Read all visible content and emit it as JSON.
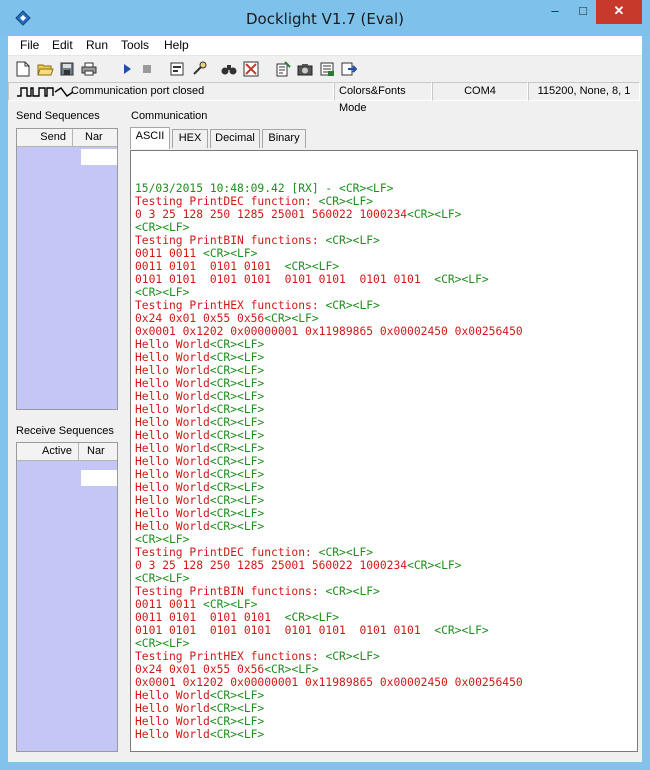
{
  "window": {
    "title": "Docklight V1.7 (Eval)",
    "min_glyph": "–",
    "max_glyph": "□",
    "close_glyph": "✕"
  },
  "menu": [
    "File",
    "Edit",
    "Run",
    "Tools",
    "Help"
  ],
  "toolbar_icons": [
    "new-file-icon",
    "open-folder-icon",
    "save-icon",
    "print-icon",
    "play-icon",
    "stop-icon",
    "properties-icon",
    "keyboard-icon",
    "binoculars-icon",
    "clear-icon",
    "edit-notes-icon",
    "snapshot-icon",
    "logging-icon",
    "export-icon"
  ],
  "status": {
    "port_text": "Communication port closed",
    "mode": "Colors&Fonts Mode",
    "com_port": "COM4",
    "settings": "115200, None, 8, 1"
  },
  "send_panel": {
    "title": "Send Sequences",
    "col_send": "Send",
    "col_name": "Nar"
  },
  "receive_panel": {
    "title": "Receive Sequences",
    "col_active": "Active",
    "col_name": "Nar"
  },
  "communication": {
    "title": "Communication",
    "tabs": [
      "ASCII",
      "HEX",
      "Decimal",
      "Binary"
    ],
    "active_tab": "ASCII"
  },
  "colors": {
    "rx_header": "#1e8c1e",
    "data_text": "#d01818",
    "control_chars": "#1e8c1e",
    "sequence_bg": "#c4c7f6",
    "titlebar": "#7ec2ec"
  },
  "terminal_lines": [
    [
      {
        "t": "",
        "c": "green"
      }
    ],
    [
      {
        "t": "15/03/2015 10:48:09.42 [RX] - <CR><LF>",
        "c": "green"
      }
    ],
    [
      {
        "t": "Testing PrintDEC function: ",
        "c": "red"
      },
      {
        "t": "<CR><LF>",
        "c": "green"
      }
    ],
    [
      {
        "t": "0 3 25 128 250 1285 25001 560022 1000234",
        "c": "red"
      },
      {
        "t": "<CR><LF>",
        "c": "green"
      }
    ],
    [
      {
        "t": "<CR><LF>",
        "c": "green"
      }
    ],
    [
      {
        "t": "Testing PrintBIN functions: ",
        "c": "red"
      },
      {
        "t": "<CR><LF>",
        "c": "green"
      }
    ],
    [
      {
        "t": "0011 0011 ",
        "c": "red"
      },
      {
        "t": "<CR><LF>",
        "c": "green"
      }
    ],
    [
      {
        "t": "0011 0101  0101 0101  ",
        "c": "red"
      },
      {
        "t": "<CR><LF>",
        "c": "green"
      }
    ],
    [
      {
        "t": "0101 0101  0101 0101  0101 0101  0101 0101  ",
        "c": "red"
      },
      {
        "t": "<CR><LF>",
        "c": "green"
      }
    ],
    [
      {
        "t": "<CR><LF>",
        "c": "green"
      }
    ],
    [
      {
        "t": "Testing PrintHEX functions: ",
        "c": "red"
      },
      {
        "t": "<CR><LF>",
        "c": "green"
      }
    ],
    [
      {
        "t": "0x24 0x01 0x55 0x56",
        "c": "red"
      },
      {
        "t": "<CR><LF>",
        "c": "green"
      }
    ],
    [
      {
        "t": "0x0001 0x1202 0x00000001 0x11989865 0x00002450 0x00256450",
        "c": "red"
      }
    ],
    [
      {
        "t": "Hello World",
        "c": "red"
      },
      {
        "t": "<CR><LF>",
        "c": "green"
      }
    ],
    [
      {
        "t": "Hello World",
        "c": "red"
      },
      {
        "t": "<CR><LF>",
        "c": "green"
      }
    ],
    [
      {
        "t": "Hello World",
        "c": "red"
      },
      {
        "t": "<CR><LF>",
        "c": "green"
      }
    ],
    [
      {
        "t": "Hello World",
        "c": "red"
      },
      {
        "t": "<CR><LF>",
        "c": "green"
      }
    ],
    [
      {
        "t": "Hello World",
        "c": "red"
      },
      {
        "t": "<CR><LF>",
        "c": "green"
      }
    ],
    [
      {
        "t": "Hello World",
        "c": "red"
      },
      {
        "t": "<CR><LF>",
        "c": "green"
      }
    ],
    [
      {
        "t": "Hello World",
        "c": "red"
      },
      {
        "t": "<CR><LF>",
        "c": "green"
      }
    ],
    [
      {
        "t": "Hello World",
        "c": "red"
      },
      {
        "t": "<CR><LF>",
        "c": "green"
      }
    ],
    [
      {
        "t": "Hello World",
        "c": "red"
      },
      {
        "t": "<CR><LF>",
        "c": "green"
      }
    ],
    [
      {
        "t": "Hello World",
        "c": "red"
      },
      {
        "t": "<CR><LF>",
        "c": "green"
      }
    ],
    [
      {
        "t": "Hello World",
        "c": "red"
      },
      {
        "t": "<CR><LF>",
        "c": "green"
      }
    ],
    [
      {
        "t": "Hello World",
        "c": "red"
      },
      {
        "t": "<CR><LF>",
        "c": "green"
      }
    ],
    [
      {
        "t": "Hello World",
        "c": "red"
      },
      {
        "t": "<CR><LF>",
        "c": "green"
      }
    ],
    [
      {
        "t": "Hello World",
        "c": "red"
      },
      {
        "t": "<CR><LF>",
        "c": "green"
      }
    ],
    [
      {
        "t": "Hello World",
        "c": "red"
      },
      {
        "t": "<CR><LF>",
        "c": "green"
      }
    ],
    [
      {
        "t": "<CR><LF>",
        "c": "green"
      }
    ],
    [
      {
        "t": "Testing PrintDEC function: ",
        "c": "red"
      },
      {
        "t": "<CR><LF>",
        "c": "green"
      }
    ],
    [
      {
        "t": "0 3 25 128 250 1285 25001 560022 1000234",
        "c": "red"
      },
      {
        "t": "<CR><LF>",
        "c": "green"
      }
    ],
    [
      {
        "t": "<CR><LF>",
        "c": "green"
      }
    ],
    [
      {
        "t": "Testing PrintBIN functions: ",
        "c": "red"
      },
      {
        "t": "<CR><LF>",
        "c": "green"
      }
    ],
    [
      {
        "t": "0011 0011 ",
        "c": "red"
      },
      {
        "t": "<CR><LF>",
        "c": "green"
      }
    ],
    [
      {
        "t": "0011 0101  0101 0101  ",
        "c": "red"
      },
      {
        "t": "<CR><LF>",
        "c": "green"
      }
    ],
    [
      {
        "t": "0101 0101  0101 0101  0101 0101  0101 0101  ",
        "c": "red"
      },
      {
        "t": "<CR><LF>",
        "c": "green"
      }
    ],
    [
      {
        "t": "<CR><LF>",
        "c": "green"
      }
    ],
    [
      {
        "t": "Testing PrintHEX functions: ",
        "c": "red"
      },
      {
        "t": "<CR><LF>",
        "c": "green"
      }
    ],
    [
      {
        "t": "0x24 0x01 0x55 0x56",
        "c": "red"
      },
      {
        "t": "<CR><LF>",
        "c": "green"
      }
    ],
    [
      {
        "t": "0x0001 0x1202 0x00000001 0x11989865 0x00002450 0x00256450",
        "c": "red"
      }
    ],
    [
      {
        "t": "Hello World",
        "c": "red"
      },
      {
        "t": "<CR><LF>",
        "c": "green"
      }
    ],
    [
      {
        "t": "Hello World",
        "c": "red"
      },
      {
        "t": "<CR><LF>",
        "c": "green"
      }
    ],
    [
      {
        "t": "Hello World",
        "c": "red"
      },
      {
        "t": "<CR><LF>",
        "c": "green"
      }
    ],
    [
      {
        "t": "Hello World",
        "c": "red"
      },
      {
        "t": "<CR><LF>",
        "c": "green"
      }
    ]
  ]
}
